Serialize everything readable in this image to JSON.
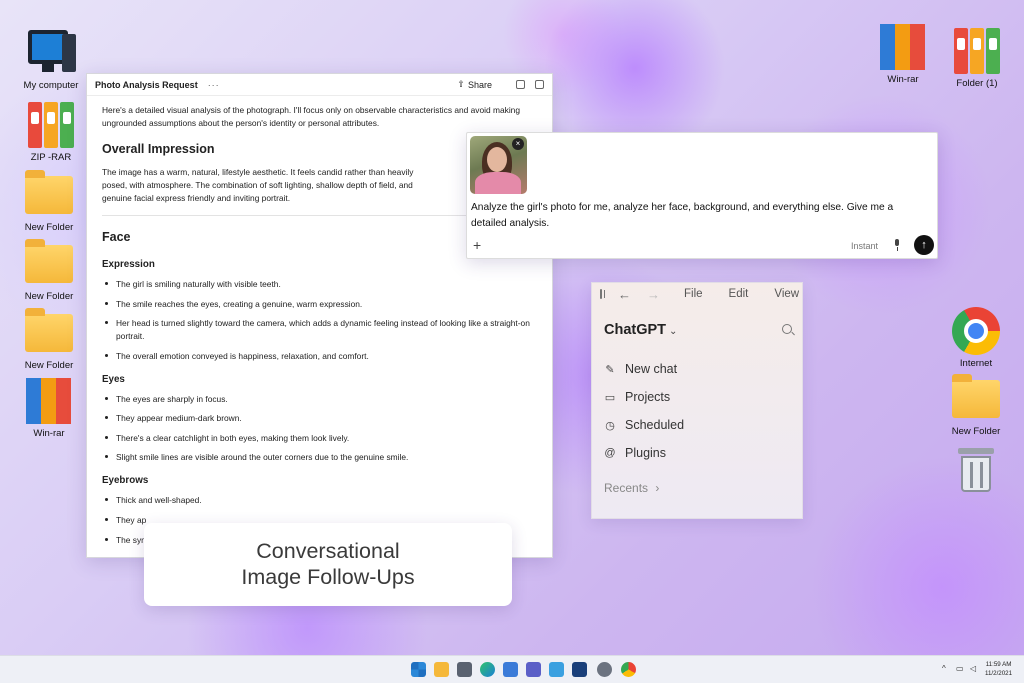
{
  "desktop": {
    "icons": [
      {
        "label": "My computer",
        "icon": "computer-icon"
      },
      {
        "label": "ZIP -RAR",
        "icon": "binders-icon"
      },
      {
        "label": "New Folder",
        "icon": "folder-icon"
      },
      {
        "label": "New Folder",
        "icon": "folder-icon"
      },
      {
        "label": "New Folder",
        "icon": "folder-icon"
      },
      {
        "label": "Win-rar",
        "icon": "winrar-icon"
      },
      {
        "label": "Win-rar",
        "icon": "winrar-icon"
      },
      {
        "label": "Folder (1)",
        "icon": "binders-icon"
      },
      {
        "label": "Internet",
        "icon": "chrome-icon"
      },
      {
        "label": "New Folder",
        "icon": "folder-icon"
      },
      {
        "label": "",
        "icon": "recycle-bin-icon"
      }
    ]
  },
  "doc": {
    "title": "Photo Analysis Request",
    "menu": "···",
    "share": "Share",
    "intro": "Here's a detailed visual analysis of the photograph. I'll focus only on observable characteristics and avoid making ungrounded assumptions about the person's identity or personal attributes.",
    "section1": {
      "heading": "Overall Impression",
      "text": "The image has a warm, natural, lifestyle aesthetic. It feels candid rather than heavily posed, with atmosphere. The combination of soft lighting, shallow depth of field, and genuine facial express friendly and inviting portrait."
    },
    "section2": {
      "heading": "Face",
      "expression": {
        "heading": "Expression",
        "items": [
          "The girl is smiling naturally with visible teeth.",
          "The smile reaches the eyes, creating a genuine, warm expression.",
          "Her head is turned slightly toward the camera, which adds a dynamic feeling instead of looking like a straight-on portrait.",
          "The overall emotion conveyed is happiness, relaxation, and comfort."
        ]
      },
      "eyes": {
        "heading": "Eyes",
        "items": [
          "The eyes are sharply in focus.",
          "They appear medium-dark brown.",
          "There's a clear catchlight in both eyes, making them look lively.",
          "Slight smile lines are visible around the outer corners due to the genuine smile."
        ]
      },
      "eyebrows": {
        "heading": "Eyebrows",
        "items": [
          "Thick and well-shaped.",
          "They ap",
          "The sym"
        ]
      }
    }
  },
  "prompt": {
    "text": "Analyze the girl's photo for me, analyze her face, background, and everything else. Give me a detailed analysis.",
    "mode": "Instant",
    "close": "×",
    "plus": "+",
    "send": "↑"
  },
  "chat": {
    "menus": [
      "File",
      "Edit",
      "View"
    ],
    "back": "←",
    "forward": "→",
    "title": "ChatGPT",
    "title_chevron": "⌄",
    "nav": [
      {
        "label": "New chat",
        "icon": "edit-icon",
        "glyph": "✎"
      },
      {
        "label": "Projects",
        "icon": "folder-outline-icon",
        "glyph": "▭"
      },
      {
        "label": "Scheduled",
        "icon": "clock-icon",
        "glyph": "◷"
      },
      {
        "label": "Plugins",
        "icon": "at-icon",
        "glyph": "@"
      }
    ],
    "recents": "Recents",
    "recents_chevron": "›"
  },
  "caption": {
    "line1": "Conversational",
    "line2": "Image Follow-Ups"
  },
  "taskbar": {
    "tray_chevron": "^",
    "time": "11:59 AM",
    "date": "11/2/2021"
  }
}
